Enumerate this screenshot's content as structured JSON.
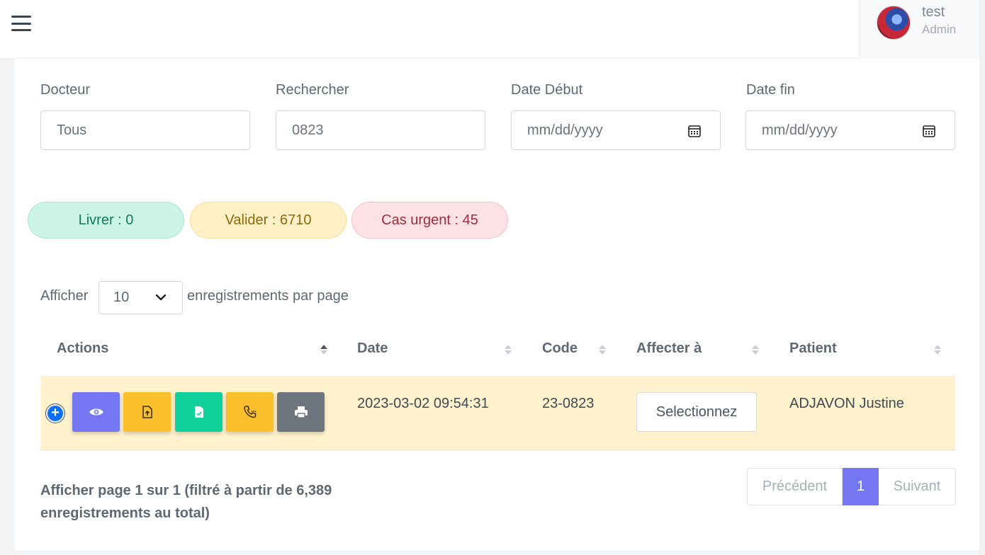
{
  "topbar": {
    "menu_icon": "hamburger-menu-icon",
    "user": {
      "name": "test",
      "role": "Admin"
    }
  },
  "filters": {
    "doctor": {
      "label": "Docteur",
      "value": "Tous"
    },
    "search": {
      "label": "Rechercher",
      "value": "0823"
    },
    "date_start": {
      "label": "Date Début",
      "placeholder": "mm/dd/yyyy",
      "icon": "calendar-icon"
    },
    "date_end": {
      "label": "Date fin",
      "placeholder": "mm/dd/yyyy",
      "icon": "calendar-icon"
    }
  },
  "stats": {
    "livrer": "Livrer : 0",
    "valider": "Valider : 6710",
    "urgent": "Cas urgent : 45"
  },
  "page_length": {
    "prefix": "Afficher",
    "value": "10",
    "suffix": "enregistrements par page"
  },
  "table": {
    "columns": [
      "Actions",
      "Date",
      "Code",
      "Affecter à",
      "Patient"
    ],
    "rows": [
      {
        "date": "2023-03-02 09:54:31",
        "code": "23-0823",
        "assign": "Selectionnez",
        "patient": "ADJAVON Justine",
        "action_icons": [
          "eye-icon",
          "file-upload-icon",
          "file-check-icon",
          "phone-call-icon",
          "print-icon"
        ]
      }
    ]
  },
  "footer": {
    "info": "Afficher page 1 sur 1 (filtré à partir de 6,389 enregistrements au total)",
    "pager": {
      "prev": "Précédent",
      "current": "1",
      "next": "Suivant"
    }
  },
  "colors": {
    "primary": "#7476f2",
    "warning": "#fcc02d",
    "success": "#10d19c",
    "secondary": "#6c757d",
    "row_highlight": "#fff2cc"
  }
}
